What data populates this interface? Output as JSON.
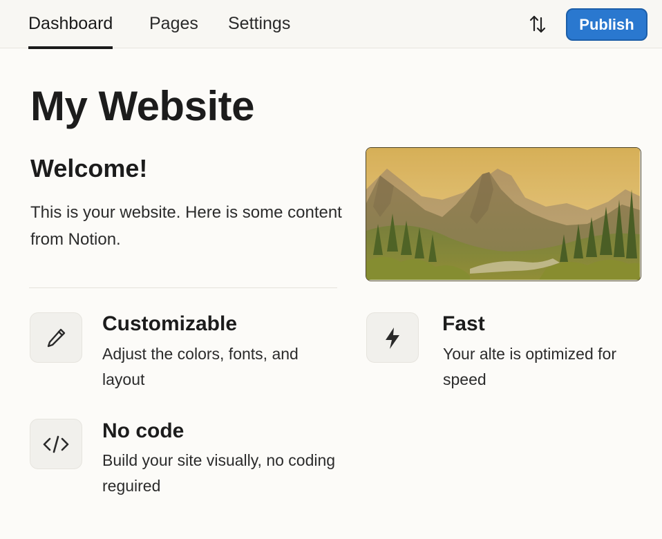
{
  "nav": {
    "tabs": [
      {
        "label": "Dashboard",
        "active": true
      },
      {
        "label": "Pages",
        "active": false
      },
      {
        "label": "Settings",
        "active": false
      }
    ],
    "sort_icon": "arrows-up-down-icon",
    "publish_label": "Publish"
  },
  "colors": {
    "accent": "#2a78cf",
    "background": "#fcfbf8",
    "text": "#1f1f1f"
  },
  "page": {
    "title": "My Website",
    "welcome_heading": "Welcome!",
    "intro_text": "This is your website. Here is some content from Notion.",
    "hero_image": "mountain-landscape-painting"
  },
  "features": [
    {
      "icon": "pencil-icon",
      "title": "Customizable",
      "description": "Adjust the colors, fonts, and layout"
    },
    {
      "icon": "lightning-bolt-icon",
      "title": "Fast",
      "description": "Your alte is optimized for speed"
    },
    {
      "icon": "code-icon",
      "title": "No code",
      "description": "Build your site visually, no coding reguired"
    }
  ]
}
